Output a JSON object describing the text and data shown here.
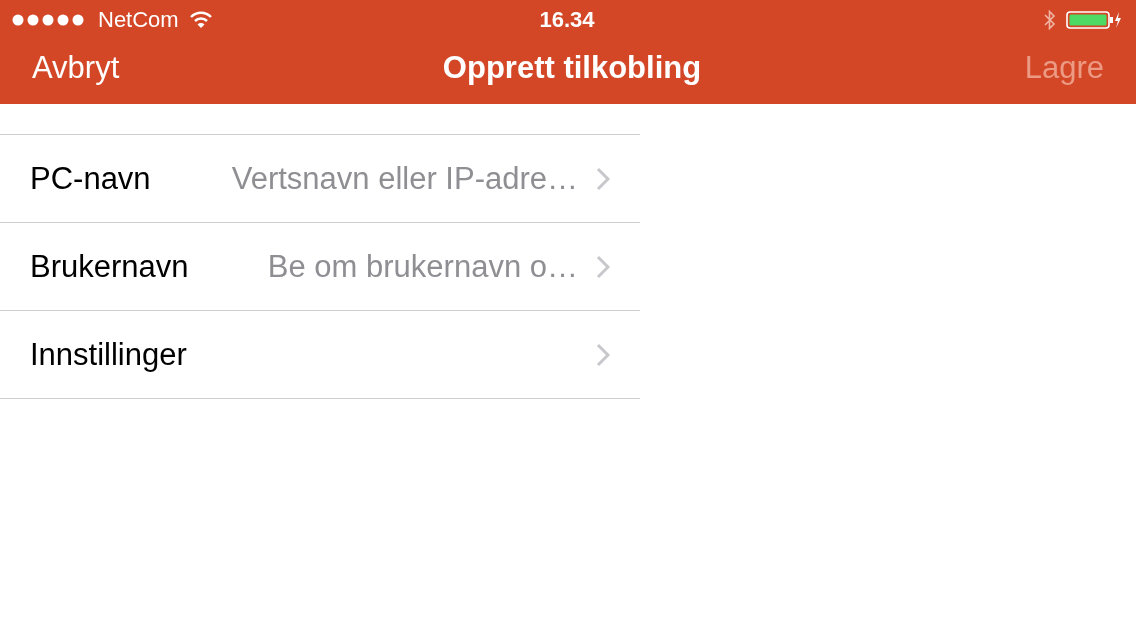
{
  "status_bar": {
    "carrier": "NetCom",
    "time": "16.34"
  },
  "nav_bar": {
    "cancel": "Avbryt",
    "title": "Opprett tilkobling",
    "save": {
      "label": "Lagre",
      "disabled": true
    }
  },
  "rows": [
    {
      "label": "PC-navn",
      "value": "Vertsnavn eller IP-adre…"
    },
    {
      "label": "Brukernavn",
      "value": "Be om brukernavn o…"
    },
    {
      "label": "Innstillinger"
    }
  ]
}
